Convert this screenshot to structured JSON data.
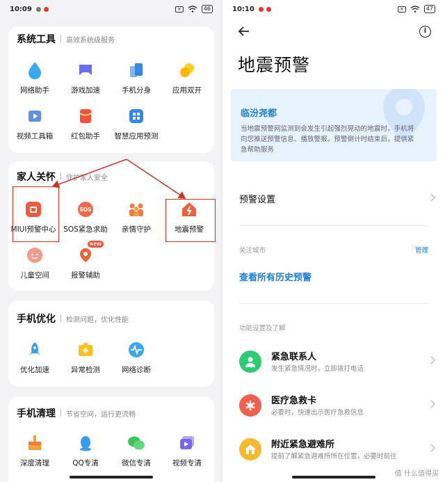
{
  "left": {
    "status": {
      "time": "10:09",
      "battery": "46"
    },
    "sections": [
      {
        "title": "系统工具",
        "subtitle": "高效系统级服务",
        "items": [
          {
            "label": "网络助手",
            "icon": "water-drop-icon"
          },
          {
            "label": "游戏加速",
            "icon": "gamepad-icon"
          },
          {
            "label": "手机分身",
            "icon": "dual-phone-icon"
          },
          {
            "label": "应用双开",
            "icon": "dual-app-icon"
          },
          {
            "label": "视频工具箱",
            "icon": "video-toolbox-icon"
          },
          {
            "label": "红包助手",
            "icon": "red-envelope-icon"
          },
          {
            "label": "智慧应用预测",
            "icon": "app-grid-icon"
          }
        ]
      },
      {
        "title": "家人关怀",
        "subtitle": "守护家人安全",
        "items": [
          {
            "label": "MIUI预警中心",
            "icon": "alert-center-icon"
          },
          {
            "label": "SOS紧急求助",
            "icon": "sos-icon"
          },
          {
            "label": "亲情守护",
            "icon": "family-icon"
          },
          {
            "label": "地震预警",
            "icon": "earthquake-house-icon"
          },
          {
            "label": "儿童空间",
            "icon": "kid-face-icon"
          },
          {
            "label": "报警辅助",
            "icon": "alarm-pin-icon",
            "badge": "NEW"
          }
        ]
      },
      {
        "title": "手机优化",
        "subtitle": "检测问题，优化性能",
        "items": [
          {
            "label": "优化加速",
            "icon": "rocket-icon"
          },
          {
            "label": "异常检测",
            "icon": "medical-kit-icon"
          },
          {
            "label": "网络诊断",
            "icon": "pulse-icon"
          }
        ]
      },
      {
        "title": "手机清理",
        "subtitle": "节省空间，运行更流畅",
        "items": [
          {
            "label": "深度清理",
            "icon": "broom-icon"
          },
          {
            "label": "QQ专清",
            "icon": "qq-icon"
          },
          {
            "label": "微信专清",
            "icon": "wechat-icon"
          },
          {
            "label": "视频专清",
            "icon": "video-clean-icon"
          }
        ]
      }
    ]
  },
  "right": {
    "status": {
      "time": "10:10",
      "battery": "47"
    },
    "page_title": "地震预警",
    "alert": {
      "city": "临汾尧都",
      "desc": "当地震预警网监测到会发生引起强烈晃动的地震时，手机将向您推送预警信息、播放警报。预警倒计时结束后，提供紧急帮助服务"
    },
    "settings_label": "预警设置",
    "followed_city_caption": "关注城市",
    "manage_label": "管理",
    "history_link": "查看所有历史预警",
    "features_caption": "功能设置及了解",
    "features": [
      {
        "title": "紧急联系人",
        "desc": "发生紧急情况时，立即拨打电话",
        "icon": "contact-person-icon",
        "color": "#2ecc71"
      },
      {
        "title": "医疗急救卡",
        "desc": "必要时，快速出示医疗急救信息",
        "icon": "medical-asterisk-icon",
        "color": "#f0604d"
      },
      {
        "title": "附近紧急避难所",
        "desc": "提前了解紧急避难所所在位置，必要时前往",
        "icon": "shelter-house-icon",
        "color": "#f5b82e"
      }
    ]
  },
  "watermark": "值 什么值得买"
}
